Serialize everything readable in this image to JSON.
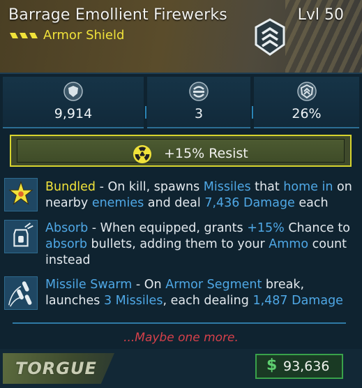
{
  "header": {
    "item_name": "Barrage Emollient Firewerks",
    "level": "Lvl 50",
    "item_type": "Armor Shield",
    "rarity_icon": "rarity-chevrons-icon",
    "emblem_icon": "shield-rank-icon",
    "colors": {
      "rarity": "#f0e23a",
      "header_bg": "#4a3f24"
    }
  },
  "stats": [
    {
      "icon": "shield-capacity-icon",
      "value": "9,914"
    },
    {
      "icon": "armor-segments-icon",
      "value": "3"
    },
    {
      "icon": "recharge-rate-icon",
      "value": "26%"
    }
  ],
  "element": {
    "icon": "radiation-icon",
    "label": "+15% Resist",
    "color": "#d7d42e"
  },
  "perks": [
    {
      "icon": "star-burst-icon",
      "parts": [
        {
          "t": "Bundled",
          "c": "name"
        },
        {
          "t": " - On kill, spawns ",
          "c": ""
        },
        {
          "t": "Missiles",
          "c": "hl"
        },
        {
          "t": " that ",
          "c": ""
        },
        {
          "t": "home in",
          "c": "hl"
        },
        {
          "t": " on nearby ",
          "c": ""
        },
        {
          "t": "enemies",
          "c": "hl"
        },
        {
          "t": " and deal ",
          "c": ""
        },
        {
          "t": "7,436 Damage",
          "c": "hl"
        },
        {
          "t": " each",
          "c": ""
        }
      ]
    },
    {
      "icon": "absorb-bullets-icon",
      "parts": [
        {
          "t": "Absorb",
          "c": "hl"
        },
        {
          "t": " - When equipped, grants ",
          "c": ""
        },
        {
          "t": "+15%",
          "c": "hl"
        },
        {
          "t": " Chance to ",
          "c": ""
        },
        {
          "t": "absorb",
          "c": "hl"
        },
        {
          "t": " bullets, adding them to your ",
          "c": ""
        },
        {
          "t": "Ammo",
          "c": "hl"
        },
        {
          "t": " count instead",
          "c": ""
        }
      ]
    },
    {
      "icon": "missile-swarm-icon",
      "parts": [
        {
          "t": "Missile Swarm",
          "c": "hl"
        },
        {
          "t": " - On ",
          "c": ""
        },
        {
          "t": "Armor Segment",
          "c": "hl"
        },
        {
          "t": " break, launches ",
          "c": ""
        },
        {
          "t": "3 Missiles",
          "c": "hl"
        },
        {
          "t": ", each dealing ",
          "c": ""
        },
        {
          "t": "1,487 Damage",
          "c": "hl"
        }
      ]
    }
  ],
  "flavor_text": "...Maybe one more.",
  "footer": {
    "manufacturer": "TORGUE",
    "currency_symbol": "$",
    "price": "93,636",
    "price_color": "#39a24a"
  }
}
